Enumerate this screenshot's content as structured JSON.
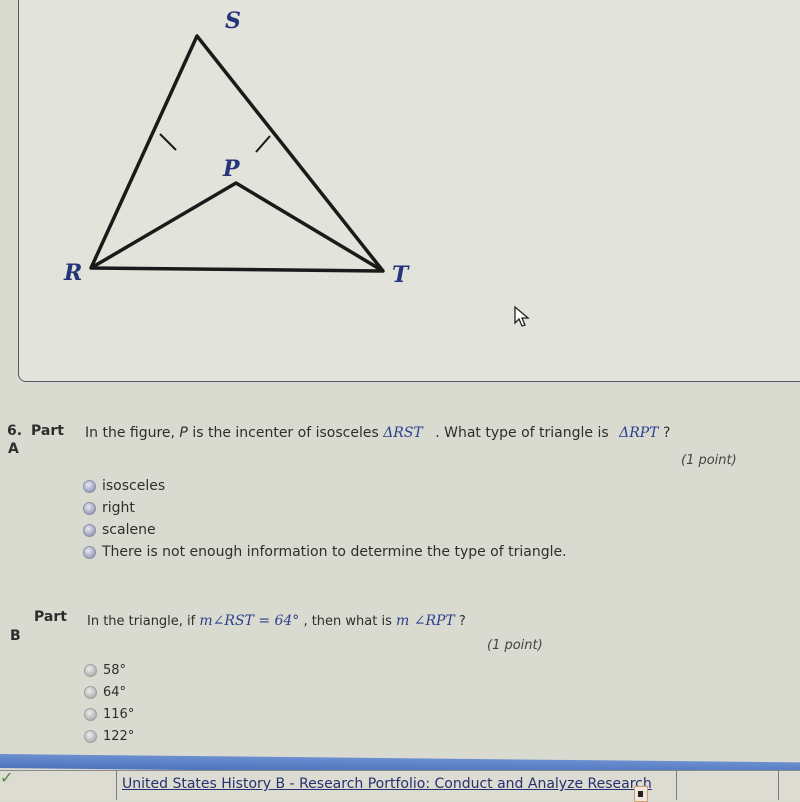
{
  "figure": {
    "vertices": {
      "S": "S",
      "P": "P",
      "R": "R",
      "T": "T"
    },
    "description": "Isosceles triangle RST with incenter P joined to R and T; tick marks on sides RS and ST"
  },
  "question": {
    "number": "6.",
    "partA": {
      "part_label": "Part",
      "part_letter": "A",
      "text_before": "In the figure, ",
      "var_p": "P",
      "text_middle": " is the incenter of isosceles ",
      "math_rst": "ΔRST",
      "text_after": " . What type of triangle is ",
      "math_rpt": "ΔRPT",
      "text_end": " ?",
      "points": "(1 point)",
      "options": [
        "isosceles",
        "right",
        "scalene",
        "There is not enough information to determine the type of triangle."
      ]
    },
    "partB": {
      "part_label": "Part",
      "part_letter": "B",
      "text_before": "In the triangle, if ",
      "math_given": "m∠RST = 64°",
      "text_middle": " , then what is ",
      "math_ask": "m ∠RPT",
      "text_end": " ?",
      "points": "(1 point)",
      "options": [
        "58°",
        "64°",
        "116°",
        "122°"
      ]
    }
  },
  "bottom_table": {
    "status_icon": "checkmark-icon",
    "link_text": "United States History B - Research Portfolio: Conduct and Analyze Research"
  },
  "colors": {
    "label_blue": "#2c3f8e",
    "bar_blue": "#5679c4",
    "check_green": "#4f8a3c"
  }
}
